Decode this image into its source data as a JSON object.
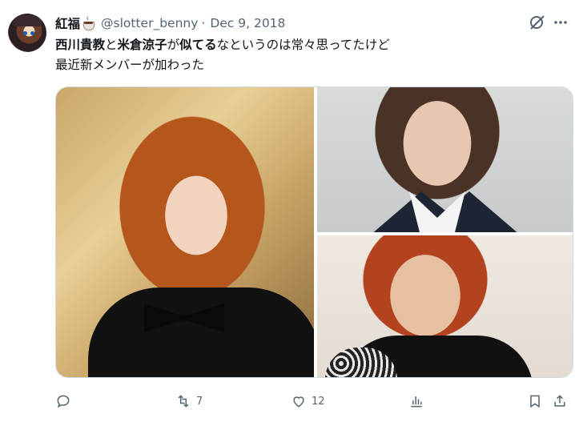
{
  "author": {
    "display_name": "紅福",
    "handle": "@slotter_benny",
    "date": "Dec 9, 2018",
    "separator": "·"
  },
  "tweet": {
    "line1": {
      "bold1": "西川貴教",
      "t1": "と",
      "bold2": "米倉涼子",
      "t2": "が",
      "bold3": "似てる",
      "t3": "なというのは常々思ってたけど"
    },
    "line2": "最近新メンバーが加わった"
  },
  "icons": {
    "grok": "grok-icon",
    "more": "more-icon",
    "reply": "reply-icon",
    "retweet": "retweet-icon",
    "like": "heart-icon",
    "views": "views-icon",
    "bookmark": "bookmark-icon",
    "share": "share-icon"
  },
  "actions": {
    "retweets": "7",
    "likes": "12"
  },
  "colors": {
    "text": "#0f1419",
    "secondary": "#536471",
    "border": "#cfd9de"
  }
}
